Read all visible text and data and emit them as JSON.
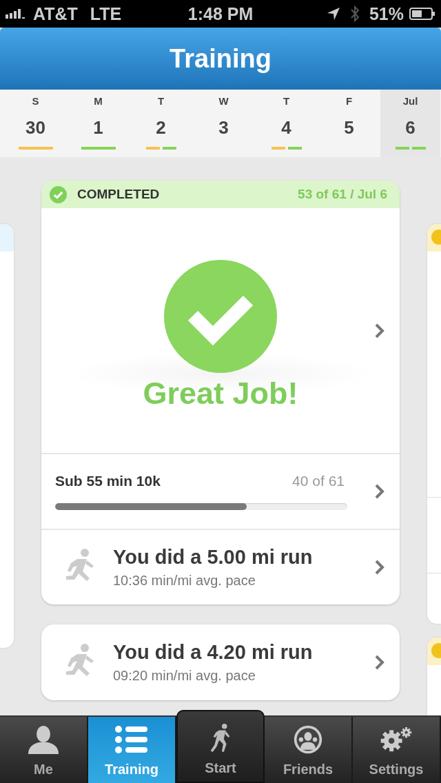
{
  "status_bar": {
    "carrier": "AT&T",
    "network": "LTE",
    "time": "1:48 PM",
    "battery": "51%"
  },
  "header": {
    "title": "Training"
  },
  "week": [
    {
      "weekday": "S",
      "date": "30",
      "selected": false,
      "marks": [
        {
          "color": "#f8c14f",
          "wide": true
        }
      ]
    },
    {
      "weekday": "M",
      "date": "1",
      "selected": false,
      "marks": [
        {
          "color": "#84d455",
          "wide": true
        }
      ]
    },
    {
      "weekday": "T",
      "date": "2",
      "selected": false,
      "marks": [
        {
          "color": "#f8c14f",
          "wide": false
        },
        {
          "color": "#84d455",
          "wide": false
        }
      ]
    },
    {
      "weekday": "W",
      "date": "3",
      "selected": false
    },
    {
      "weekday": "T",
      "date": "4",
      "selected": false,
      "marks": [
        {
          "color": "#f8c14f",
          "wide": false
        },
        {
          "color": "#84d455",
          "wide": false
        }
      ]
    },
    {
      "weekday": "F",
      "date": "5",
      "selected": false
    },
    {
      "weekday": "Jul",
      "date": "6",
      "selected": true,
      "marks": [
        {
          "color": "#84d455",
          "wide": false
        },
        {
          "color": "#84d455",
          "wide": false
        }
      ]
    }
  ],
  "card": {
    "status": "COMPLETED",
    "progress": "53 of 61 / Jul 6",
    "message": "Great Job!",
    "goal": {
      "name": "Sub 55 min 10k",
      "count": "40 of 61",
      "level": 0.655
    },
    "runs": [
      {
        "title": "You did a 5.00 mi run",
        "pace": "10:36 min/mi avg. pace"
      }
    ]
  },
  "more_runs": [
    {
      "title": "You did a 4.20 mi run",
      "pace": "09:20 min/mi avg. pace"
    }
  ],
  "tab_bar": [
    {
      "label": "Me",
      "kind": "person",
      "selected": false
    },
    {
      "label": "Training",
      "kind": "list",
      "selected": true
    },
    {
      "label": "Start",
      "kind": "runner",
      "selected": false
    },
    {
      "label": "Friends",
      "kind": "group",
      "selected": false
    },
    {
      "label": "Settings",
      "kind": "gears",
      "selected": false
    }
  ]
}
